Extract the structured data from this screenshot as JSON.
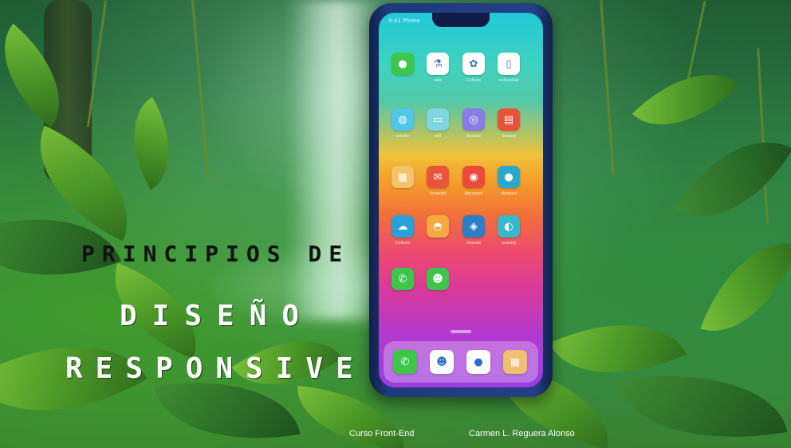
{
  "slide": {
    "title_line1": "PRINCIPIOS DE",
    "title_line2": "DISEÑO",
    "title_line3": "RESPONSIVE",
    "course": "Curso Front-End",
    "author": "Carmen L. Reguera Alonso"
  },
  "phone": {
    "status_text": "9:41 Phone",
    "apps": [
      {
        "name": "messages-icon",
        "label": "",
        "color": "#3cc74a",
        "glyph": "●"
      },
      {
        "name": "tool-icon",
        "label": "sale",
        "color": "#ffffff",
        "glyph": "⚗"
      },
      {
        "name": "photos-icon",
        "label": "Culture",
        "color": "#ffffff",
        "glyph": "✿"
      },
      {
        "name": "notes-icon",
        "label": "culturelist",
        "color": "#ffffff",
        "glyph": "▯"
      },
      {
        "name": "weather-icon",
        "label": "oreste",
        "color": "#4fc7e8",
        "glyph": "◍"
      },
      {
        "name": "card-icon",
        "label": "sell",
        "color": "#7fd6e0",
        "glyph": "▭"
      },
      {
        "name": "clock-icon",
        "label": "Sessed",
        "color": "#8a7be6",
        "glyph": "◎"
      },
      {
        "name": "reader-icon",
        "label": "Sessed",
        "color": "#e8523a",
        "glyph": "▤"
      },
      {
        "name": "folder-icon",
        "label": "",
        "color": "#f4c36a",
        "glyph": "▦"
      },
      {
        "name": "mail-icon",
        "label": "acsessid",
        "color": "#e8553a",
        "glyph": "✉"
      },
      {
        "name": "camera-icon",
        "label": "Aacusgot",
        "color": "#ec4a3a",
        "glyph": "◉"
      },
      {
        "name": "chat-icon",
        "label": "sleeped",
        "color": "#2aa8c8",
        "glyph": "●"
      },
      {
        "name": "cloud-icon",
        "label": "Culture",
        "color": "#2aa0d8",
        "glyph": "☁"
      },
      {
        "name": "bag-icon",
        "label": "",
        "color": "#f5a940",
        "glyph": "◓"
      },
      {
        "name": "maps-icon",
        "label": "Sessed",
        "color": "#2b7fc8",
        "glyph": "◈"
      },
      {
        "name": "compass-icon",
        "label": "acesed",
        "color": "#3ab7c8",
        "glyph": "◐"
      },
      {
        "name": "phone-icon",
        "label": "",
        "color": "#3cc74a",
        "glyph": "✆"
      },
      {
        "name": "contacts-icon",
        "label": "",
        "color": "#3cc74a",
        "glyph": "☻"
      }
    ],
    "dock": [
      {
        "name": "dock-phone-icon",
        "color": "#3cc74a",
        "glyph": "✆"
      },
      {
        "name": "dock-profile-icon",
        "color": "#ffffff",
        "glyph": "☻"
      },
      {
        "name": "dock-messages-icon",
        "color": "#ffffff",
        "glyph": "●"
      },
      {
        "name": "dock-gallery-icon",
        "color": "#f0c070",
        "glyph": "▦"
      }
    ]
  }
}
